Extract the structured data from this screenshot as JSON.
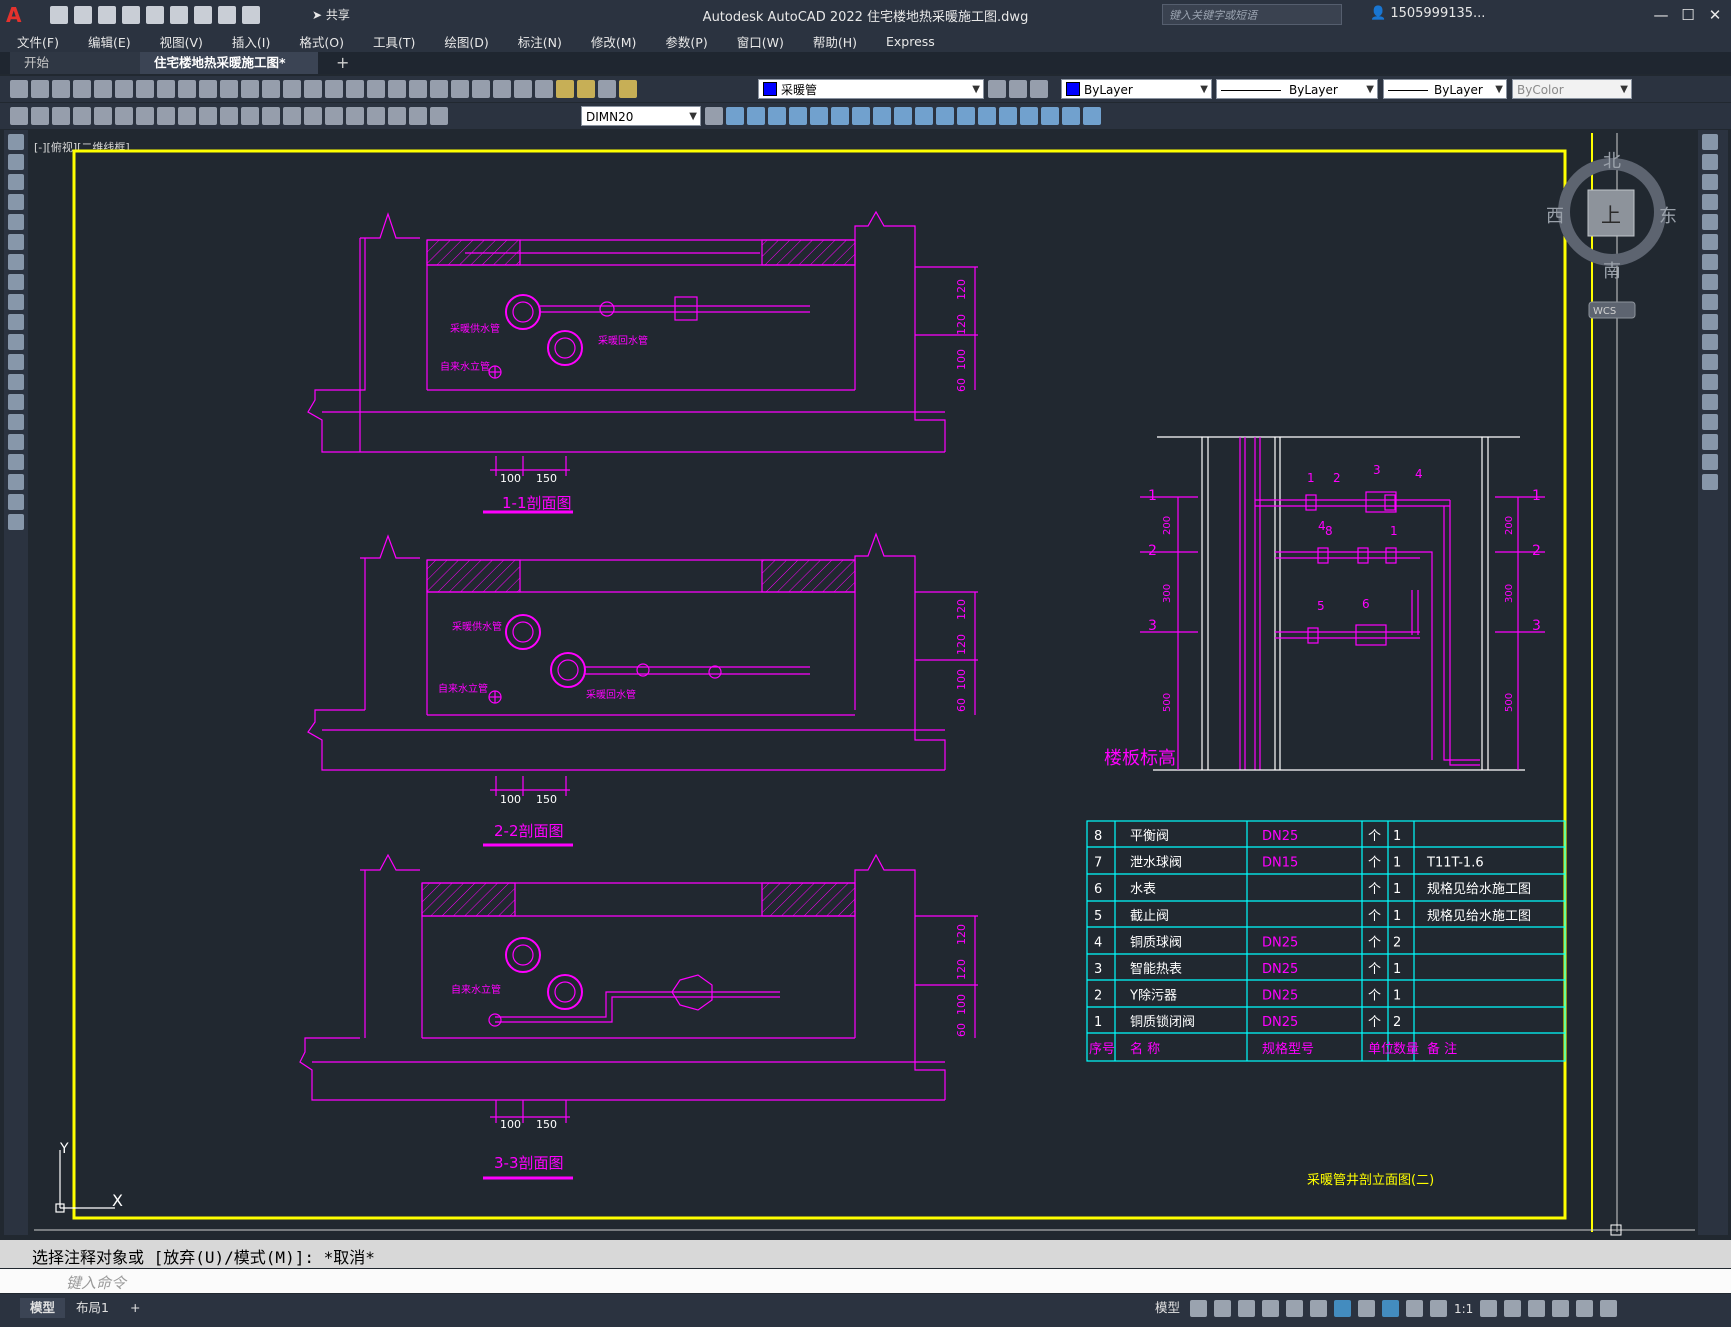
{
  "app": {
    "title": "Autodesk AutoCAD 2022    住宅楼地热采暖施工图.dwg",
    "logo": "A",
    "share_label": "共享",
    "search_placeholder": "键入关键字或短语",
    "user_label": "1505999135...",
    "minimize": "—",
    "maximize": "☐",
    "close": "✕"
  },
  "menu": [
    "文件(F)",
    "编辑(E)",
    "视图(V)",
    "插入(I)",
    "格式(O)",
    "工具(T)",
    "绘图(D)",
    "标注(N)",
    "修改(M)",
    "参数(P)",
    "窗口(W)",
    "帮助(H)",
    "Express"
  ],
  "tabs": {
    "start": "开始",
    "document": "住宅楼地热采暖施工图*",
    "close": "✕",
    "add": "+"
  },
  "properties": {
    "layer": "采暖管",
    "color": "ByLayer",
    "linetype": "ByLayer",
    "lineweight": "ByLayer",
    "plotstyle": "ByColor",
    "dimstyle": "DIMN20",
    "layer_color": "#0000ff"
  },
  "viewport": {
    "label": "[-][俯视][二维线框]",
    "viewcube": {
      "north": "北",
      "south": "南",
      "east": "东",
      "west": "西",
      "top": "上",
      "wcs": "WCS"
    },
    "ucs": {
      "x": "X",
      "y": "Y"
    }
  },
  "drawing": {
    "sections": [
      {
        "title": "1-1剖面图",
        "supply_label": "采暖供水管",
        "return_label": "采暖回水管",
        "tap_label": "自来水立管"
      },
      {
        "title": "2-2剖面图",
        "supply_label": "采暖供水管",
        "return_label": "采暖回水管",
        "tap_label": "自来水立管"
      },
      {
        "title": "3-3剖面图",
        "tap_label": "自来水立管"
      }
    ],
    "dims": {
      "d120a": "120",
      "d120b": "120",
      "d100": "100",
      "d60": "60",
      "w100": "100",
      "w150": "150"
    },
    "elevation": {
      "floor_label": "楼板标高",
      "left_dims": [
        "200",
        "300",
        "500"
      ],
      "right_dims": [
        "200",
        "300",
        "500"
      ],
      "levels": [
        "1",
        "2",
        "3"
      ],
      "items": [
        "1",
        "2",
        "3",
        "4",
        "5",
        "6",
        "8",
        "1",
        "4"
      ]
    },
    "bom": {
      "header": [
        "序号",
        "名    称",
        "规格型号",
        "单位",
        "数量",
        "备    注"
      ],
      "rows": [
        [
          "8",
          "平衡阀",
          "DN25",
          "个",
          "1",
          ""
        ],
        [
          "7",
          "泄水球阀",
          "DN15",
          "个",
          "1",
          "T11T-1.6"
        ],
        [
          "6",
          "水表",
          "",
          "个",
          "1",
          "规格见给水施工图"
        ],
        [
          "5",
          "截止阀",
          "",
          "个",
          "1",
          "规格见给水施工图"
        ],
        [
          "4",
          "铜质球阀",
          "DN25",
          "个",
          "2",
          ""
        ],
        [
          "3",
          "智能热表",
          "DN25",
          "个",
          "1",
          ""
        ],
        [
          "2",
          "Y除污器",
          "DN25",
          "个",
          "1",
          ""
        ],
        [
          "1",
          "铜质锁闭阀",
          "DN25",
          "个",
          "2",
          ""
        ]
      ]
    },
    "sheet_title": "采暖管井剖立面图(二)"
  },
  "command": {
    "history": "选择注释对象或 [放弃(U)/模式(M)]: *取消*",
    "placeholder": "键入命令"
  },
  "status": {
    "model_tab": "模型",
    "layout_tab": "布局1",
    "add": "+",
    "model_label": "模型",
    "scale": "1:1"
  },
  "colors": {
    "magenta": "#ff00ff",
    "cyan": "#00ffff",
    "yellow": "#ffff00",
    "white": "#ffffff",
    "background": "#212830"
  }
}
